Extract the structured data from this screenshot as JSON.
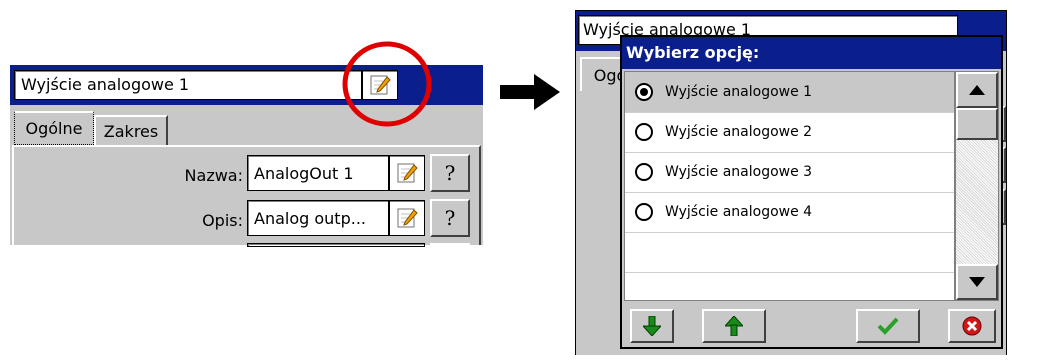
{
  "left": {
    "title_field": "Wyjście analogowe 1",
    "tabs": [
      "Ogólne",
      "Zakres"
    ],
    "fields": [
      {
        "label": "Nazwa:",
        "value": "AnalogOut 1"
      },
      {
        "label": "Opis:",
        "value": "Analog outp..."
      }
    ],
    "help_glyph": "?"
  },
  "right": {
    "bg_title_field": "Wyjście analogowe 1",
    "bg_tab": "Ogó",
    "dialog": {
      "title": "Wybierz opcję:",
      "options": [
        {
          "label": "Wyjście analogowe 1",
          "selected": true
        },
        {
          "label": "Wyjście analogowe 2",
          "selected": false
        },
        {
          "label": "Wyjście analogowe 3",
          "selected": false
        },
        {
          "label": "Wyjście analogowe 4",
          "selected": false
        }
      ]
    }
  },
  "colors": {
    "titlebar": "#0a1e8c",
    "annotation_red": "#e00000",
    "window_bg": "#c8c8c8"
  },
  "icons": [
    "edit-icon",
    "help-icon",
    "scroll-up-icon",
    "scroll-down-icon",
    "arrow-down-icon",
    "arrow-up-icon",
    "checkmark-icon",
    "cancel-icon",
    "right-arrow-icon"
  ]
}
